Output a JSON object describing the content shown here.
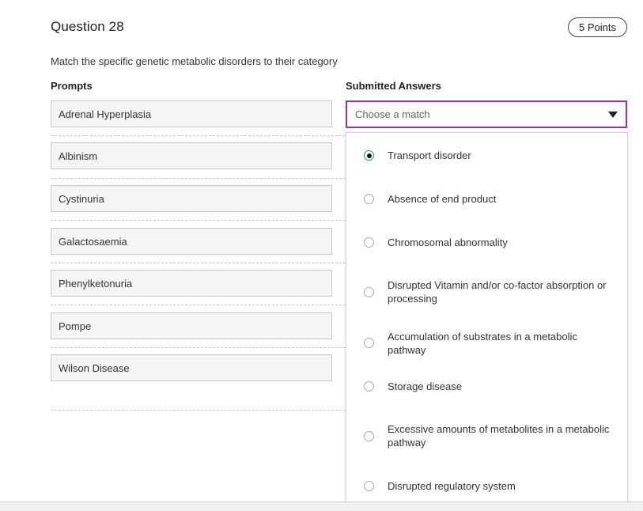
{
  "question": {
    "title": "Question 28",
    "points": "5 Points",
    "instructions": "Match the specific genetic metabolic disorders to their category"
  },
  "columns": {
    "prompts": "Prompts",
    "answers": "Submitted Answers"
  },
  "prompts": [
    "Adrenal Hyperplasia",
    "Albinism",
    "Cystinuria",
    "Galactosaemia",
    "Phenylketonuria",
    "Pompe",
    "Wilson Disease"
  ],
  "select": {
    "placeholder": "Choose a match",
    "icon": "caret-down-icon"
  },
  "options": [
    {
      "label": "Transport disorder",
      "selected": true
    },
    {
      "label": "Absence of end product",
      "selected": false
    },
    {
      "label": "Chromosomal abnormality",
      "selected": false
    },
    {
      "label": "Disrupted Vitamin and/or co-factor absorption or processing",
      "selected": false
    },
    {
      "label": "Accumulation of substrates in a metabolic pathway",
      "selected": false
    },
    {
      "label": "Storage disease",
      "selected": false
    },
    {
      "label": "Excessive amounts of metabolites in a metabolic pathway",
      "selected": false
    },
    {
      "label": "Disrupted regulatory system",
      "selected": false
    }
  ],
  "colors": {
    "select_border": "#9b2fae",
    "radio_selected": "#1f9a4a"
  }
}
